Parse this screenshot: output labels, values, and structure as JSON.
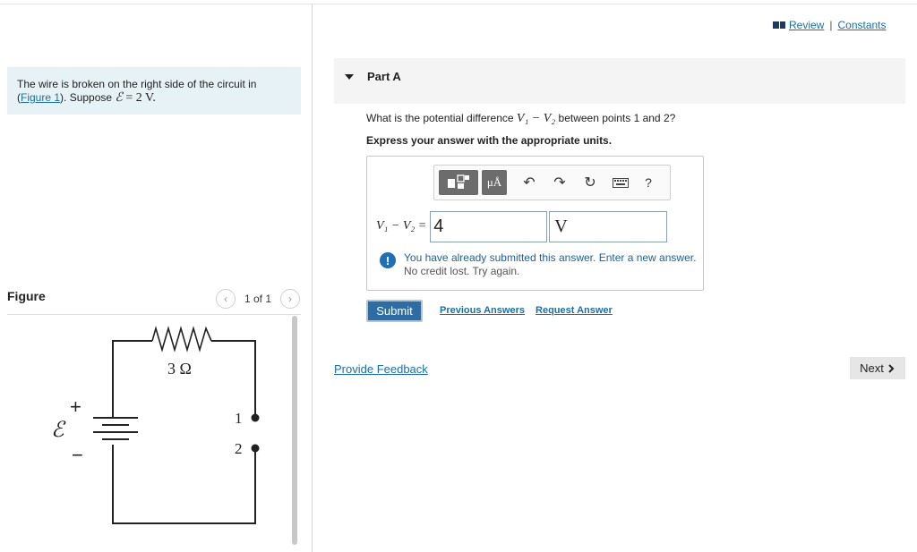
{
  "problem": {
    "text_before_link": "The wire is broken on the right side of the circuit in (",
    "figure_link": "Figure 1",
    "text_after_link": "). Suppose ",
    "emf_symbol": "ℰ",
    "emf_value": " = 2 V."
  },
  "figure": {
    "label": "Figure",
    "pager": "1 of 1",
    "prev_icon": "chevron-left-icon",
    "next_icon": "chevron-right-icon",
    "circuit": {
      "resistor_label": "3 Ω",
      "emf_label": "ℰ",
      "plus": "+",
      "minus": "−",
      "point1": "1",
      "point2": "2"
    }
  },
  "header": {
    "review": "Review",
    "separator": "|",
    "constants": "Constants"
  },
  "part": {
    "title": "Part A",
    "question_before": "What is the potential difference ",
    "question_math": "V₁ − V₂",
    "question_after": " between points 1 and 2?",
    "instruction": "Express your answer with the appropriate units."
  },
  "toolbar": {
    "template_icon": "template-icon",
    "units_label": "μÅ",
    "undo_icon": "undo-icon",
    "redo_icon": "redo-icon",
    "reset_icon": "reset-icon",
    "keyboard_icon": "keyboard-icon",
    "help_label": "?"
  },
  "answer": {
    "label": "V₁ − V₂ =",
    "value": "4",
    "units": "V",
    "feedback_line1": "You have already submitted this answer. Enter a new answer.",
    "feedback_line2": "No credit lost. Try again.",
    "feedback_icon": "!"
  },
  "actions": {
    "submit": "Submit",
    "previous_answers": "Previous Answers",
    "request_answer": "Request Answer",
    "provide_feedback": "Provide Feedback",
    "next": "Next"
  },
  "colors": {
    "link": "#1b6fa6",
    "submit_bg": "#2e6da4",
    "problem_bg": "#e7f2f7"
  }
}
